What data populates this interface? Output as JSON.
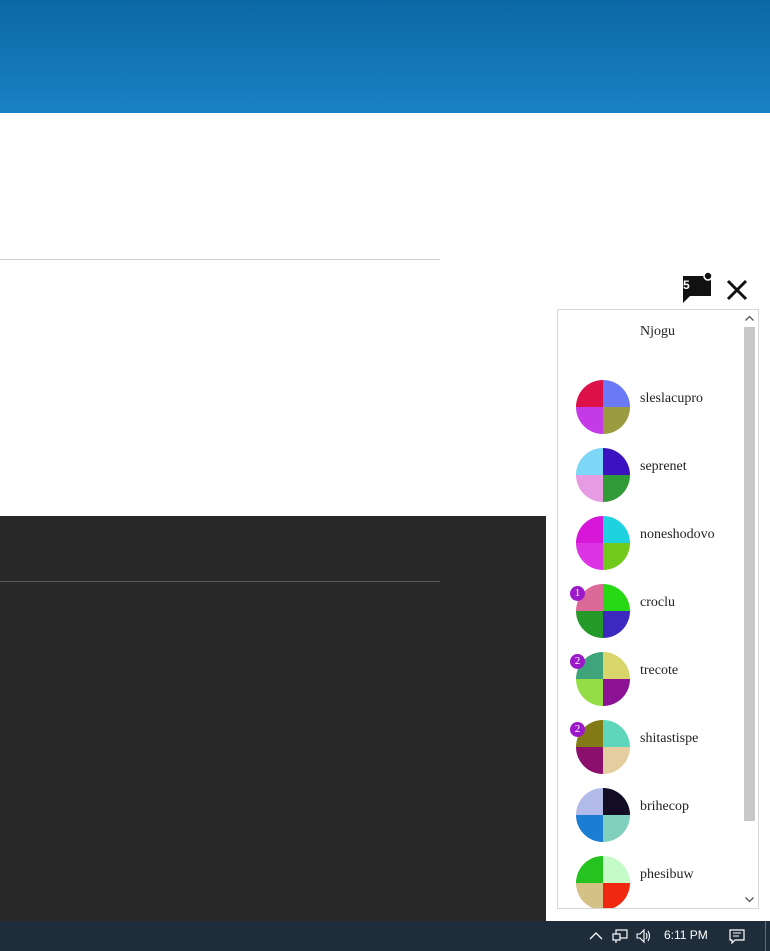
{
  "chat": {
    "unread_count": "5",
    "contacts": [
      {
        "name": "Njogu",
        "badge": "",
        "colors": [
          "#ffffff",
          "#ffffff",
          "#ffffff",
          "#ffffff"
        ]
      },
      {
        "name": "sleslacupro",
        "badge": "",
        "colors": [
          "#dc1147",
          "#6a7af7",
          "#c43ae6",
          "#9a9a3e"
        ]
      },
      {
        "name": "seprenet",
        "badge": "",
        "colors": [
          "#7dd7f6",
          "#3c12c0",
          "#e79be2",
          "#2f9a36"
        ]
      },
      {
        "name": "noneshodovo",
        "badge": "",
        "colors": [
          "#d717d7",
          "#1fd2e0",
          "#dc34e3",
          "#71c91b"
        ]
      },
      {
        "name": "croclu",
        "badge": "1",
        "colors": [
          "#dc6a98",
          "#27d815",
          "#259a2b",
          "#3c29c0"
        ]
      },
      {
        "name": "trecote",
        "badge": "2",
        "colors": [
          "#3fa47a",
          "#d8d56a",
          "#95dd47",
          "#8b1293"
        ]
      },
      {
        "name": "shitastispe",
        "badge": "2",
        "colors": [
          "#817a15",
          "#5dd6bb",
          "#8b0f6c",
          "#e4cd9e"
        ]
      },
      {
        "name": "brihecop",
        "badge": "",
        "colors": [
          "#b2baea",
          "#120c25",
          "#1c7ed3",
          "#81d0bd"
        ]
      },
      {
        "name": "phesibuw",
        "badge": "",
        "colors": [
          "#26c21f",
          "#c4fbc6",
          "#d4c185",
          "#f0280f"
        ]
      }
    ]
  },
  "taskbar": {
    "time": "6:11 PM"
  },
  "colors": {
    "header": "#1a82c4",
    "footer": "#282828",
    "badge": "#9c19c9",
    "taskbar": "#1f2d3b"
  }
}
